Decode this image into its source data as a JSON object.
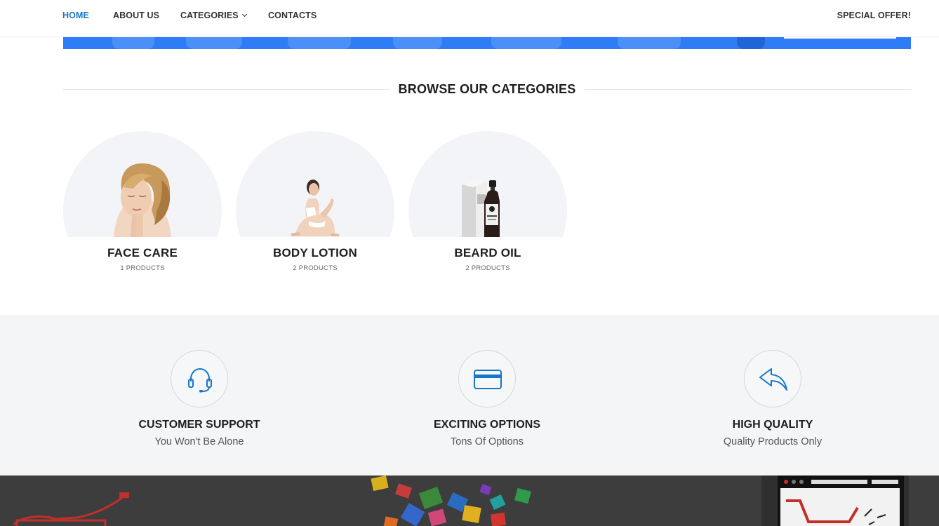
{
  "nav": {
    "home": "HOME",
    "about": "ABOUT US",
    "categories": "CATEGORIES",
    "contacts": "CONTACTS",
    "special": "SPECIAL OFFER!"
  },
  "section": {
    "title": "BROWSE OUR CATEGORIES"
  },
  "categories": [
    {
      "name": "FACE CARE",
      "count": "1 PRODUCTS"
    },
    {
      "name": "BODY LOTION",
      "count": "2 PRODUCTS"
    },
    {
      "name": "BEARD OIL",
      "count": "2 PRODUCTS"
    }
  ],
  "features": [
    {
      "icon": "headset-icon",
      "title": "CUSTOMER SUPPORT",
      "subtitle": "You Won't Be Alone"
    },
    {
      "icon": "credit-card-icon",
      "title": "EXCITING OPTIONS",
      "subtitle": "Tons Of Options"
    },
    {
      "icon": "reply-arrow-icon",
      "title": "HIGH QUALITY",
      "subtitle": "Quality Products Only"
    }
  ],
  "colors": {
    "accent": "#1677c8",
    "banner": "#2e7cf6",
    "feature_bg": "#f4f5f7",
    "dark_bg": "#3d3d3d"
  }
}
